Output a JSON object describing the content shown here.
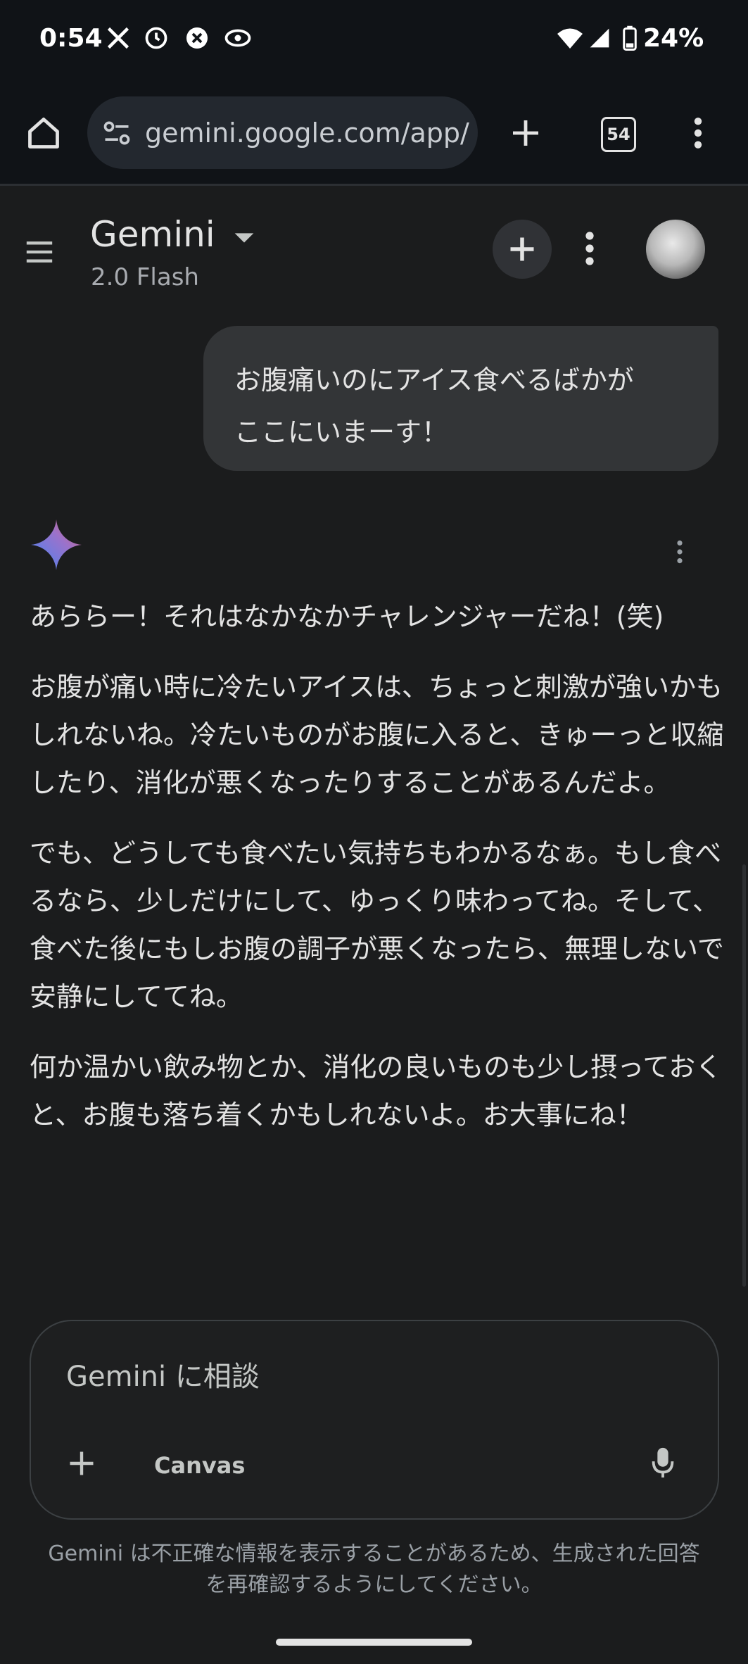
{
  "status_bar": {
    "time": "0:54",
    "battery": "24%",
    "icons": [
      "x-icon",
      "alarm-icon",
      "close-circle-icon",
      "eye-icon",
      "wifi-icon",
      "signal-icon",
      "battery-icon"
    ]
  },
  "browser": {
    "url": "gemini.google.com/app/",
    "tab_count": "54"
  },
  "app": {
    "title": "Gemini",
    "model": "2.0 Flash"
  },
  "chat": {
    "user_message_line1": "お腹痛いのにアイス食べるばかが",
    "user_message_line2": "ここにいまーす！",
    "response": [
      "あららー！それはなかなかチャレンジャーだね！(笑)",
      "お腹が痛い時に冷たいアイスは、ちょっと刺激が強いかもしれないね。冷たいものがお腹に入ると、きゅーっと収縮したり、消化が悪くなったりすることがあるんだよ。",
      "でも、どうしても食べたい気持ちもわかるなぁ。もし食べるなら、少しだけにして、ゆっくり味わってね。そして、食べた後にもしお腹の調子が悪くなったら、無理しないで安静にしててね。",
      "何か温かい飲み物とか、消化の良いものも少し摂っておくと、お腹も落ち着くかもしれないよ。お大事にね！"
    ]
  },
  "input": {
    "placeholder": "Gemini に相談",
    "canvas_label": "Canvas"
  },
  "disclaimer_line1": "Gemini は不正確な情報を表示することがあるため、生成された回答",
  "disclaimer_line2": "を再確認するようにしてください。",
  "colors": {
    "background": "#1b1c1d",
    "bubble": "#333537",
    "url_pill": "#23282f",
    "text": "#e3e3e3"
  }
}
